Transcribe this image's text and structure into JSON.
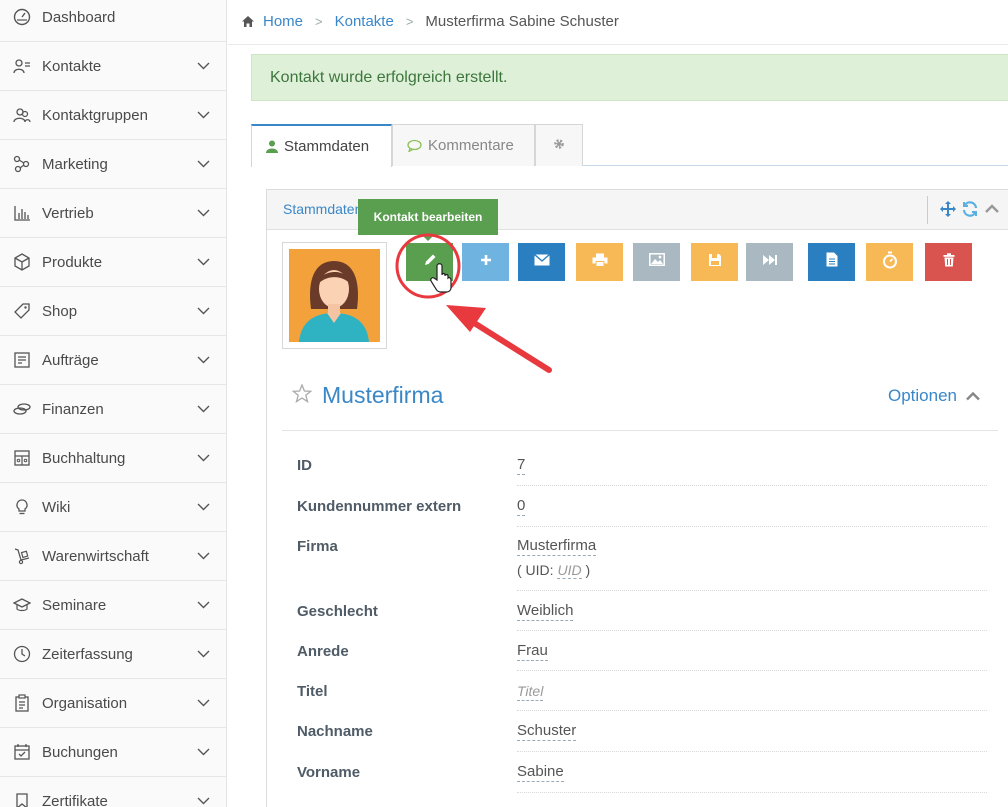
{
  "sidebar": {
    "items": [
      {
        "label": "Dashboard",
        "icon": "dashboard-icon",
        "expandable": false
      },
      {
        "label": "Kontakte",
        "icon": "contacts-icon",
        "expandable": true
      },
      {
        "label": "Kontaktgruppen",
        "icon": "contact-groups-icon",
        "expandable": true
      },
      {
        "label": "Marketing",
        "icon": "marketing-icon",
        "expandable": true
      },
      {
        "label": "Vertrieb",
        "icon": "sales-chart-icon",
        "expandable": true
      },
      {
        "label": "Produkte",
        "icon": "box-icon",
        "expandable": true
      },
      {
        "label": "Shop",
        "icon": "tag-icon",
        "expandable": true
      },
      {
        "label": "Aufträge",
        "icon": "orders-icon",
        "expandable": true
      },
      {
        "label": "Finanzen",
        "icon": "coins-icon",
        "expandable": true
      },
      {
        "label": "Buchhaltung",
        "icon": "accounting-icon",
        "expandable": true
      },
      {
        "label": "Wiki",
        "icon": "lightbulb-icon",
        "expandable": true
      },
      {
        "label": "Warenwirtschaft",
        "icon": "hand-truck-icon",
        "expandable": true
      },
      {
        "label": "Seminare",
        "icon": "graduation-cap-icon",
        "expandable": true
      },
      {
        "label": "Zeiterfassung",
        "icon": "clock-icon",
        "expandable": true
      },
      {
        "label": "Organisation",
        "icon": "clipboard-icon",
        "expandable": true
      },
      {
        "label": "Buchungen",
        "icon": "calendar-check-icon",
        "expandable": true
      },
      {
        "label": "Zertifikate",
        "icon": "bookmark-icon",
        "expandable": true
      }
    ]
  },
  "breadcrumb": {
    "home": "Home",
    "contacts": "Kontakte",
    "current": "Musterfirma Sabine Schuster"
  },
  "alert": {
    "message": "Kontakt wurde erfolgreich erstellt."
  },
  "tabs": [
    {
      "label": "Stammdaten",
      "icon": "user-icon",
      "active": true
    },
    {
      "label": "Kommentare",
      "icon": "comment-icon",
      "active": false
    },
    {
      "label": "",
      "icon": "gear-icon",
      "active": false
    }
  ],
  "panel": {
    "title": "Stammdaten",
    "tooltip": "Kontakt bearbeiten"
  },
  "actions": [
    {
      "name": "edit-button",
      "icon": "pencil-icon",
      "color": "#5a9e4f"
    },
    {
      "name": "add-button",
      "icon": "plus-icon",
      "color": "#6fb3e0"
    },
    {
      "name": "email-button",
      "icon": "envelope-icon",
      "color": "#2a7fc0"
    },
    {
      "name": "print-button",
      "icon": "print-icon",
      "color": "#f7b955"
    },
    {
      "name": "image-button",
      "icon": "image-icon",
      "color": "#a9b8c1"
    },
    {
      "name": "save-button",
      "icon": "floppy-icon",
      "color": "#f7b955"
    },
    {
      "name": "forward-button",
      "icon": "fast-forward-icon",
      "color": "#a9b8c1"
    },
    {
      "name": "document-button",
      "icon": "document-icon",
      "color": "#2a7fc0"
    },
    {
      "name": "timer-button",
      "icon": "stopwatch-icon",
      "color": "#f7b955"
    },
    {
      "name": "delete-button",
      "icon": "trash-icon",
      "color": "#d9534f"
    }
  ],
  "contact": {
    "company": "Musterfirma",
    "options_label": "Optionen"
  },
  "fields": [
    {
      "label": "ID",
      "value": "7"
    },
    {
      "label": "Kundennummer extern",
      "value": "0"
    },
    {
      "label": "Firma",
      "value": "Musterfirma",
      "uid_prefix": "( UID:",
      "uid_value": "UID",
      "uid_suffix": ")"
    },
    {
      "label": "Geschlecht",
      "value": "Weiblich"
    },
    {
      "label": "Anrede",
      "value": "Frau"
    },
    {
      "label": "Titel",
      "value": "Titel",
      "placeholder": true
    },
    {
      "label": "Nachname",
      "value": "Schuster"
    },
    {
      "label": "Vorname",
      "value": "Sabine"
    }
  ],
  "colors": {
    "accent": "#3a87c8",
    "success_bg": "#dff0d8",
    "success_text": "#3c763d",
    "annotation_red": "#e8393f"
  }
}
